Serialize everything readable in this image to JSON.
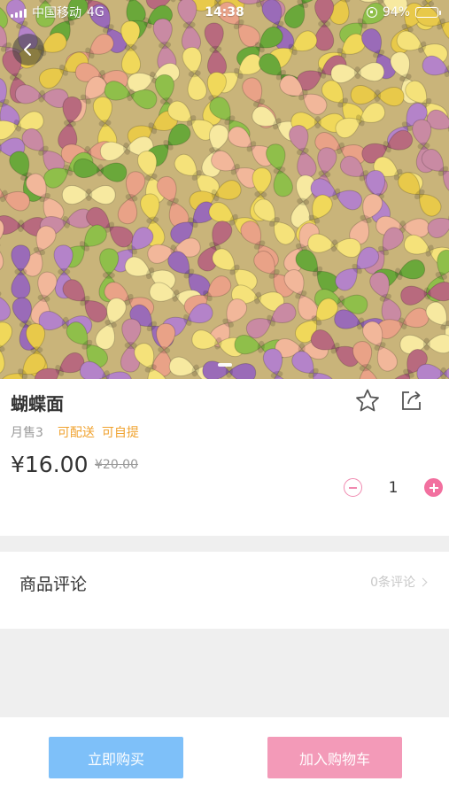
{
  "status_bar": {
    "carrier": "中国移动",
    "network": "4G",
    "time": "14:38",
    "battery": "94%",
    "battery_level": 0.94
  },
  "product": {
    "title": "蝴蝶面",
    "sold": "月售3",
    "tags": [
      "可配送",
      "可自提"
    ],
    "price": "¥16.00",
    "original_price": "¥20.00",
    "quantity": "1"
  },
  "reviews": {
    "label": "商品评论",
    "count": "0条评论"
  },
  "actions": {
    "buy_now": "立即购买",
    "add_to_cart": "加入购物车"
  },
  "colors": {
    "accent_pink": "#f2709f",
    "buy_blue": "#7ec0f9",
    "cart_pink": "#f39ab8",
    "tag_orange": "#f0a22e"
  },
  "icons": {
    "back": "chevron-left-icon",
    "favorite": "star-icon",
    "share": "share-icon",
    "minus": "minus-icon",
    "plus": "plus-icon"
  }
}
